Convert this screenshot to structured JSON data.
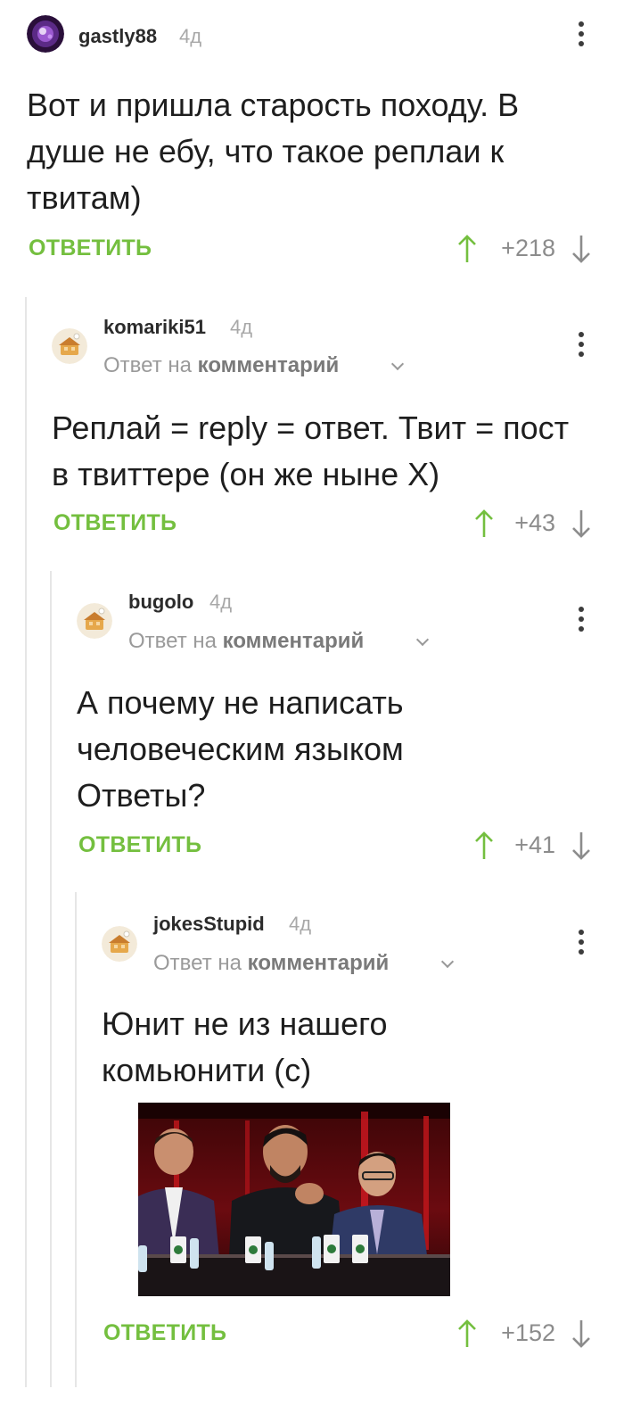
{
  "comments": [
    {
      "username": "gastly88",
      "age": "4д",
      "text": "Вот и пришла старость походу. В душе не ебу, что такое реплаи к твитам)",
      "reply_label": "ОТВЕТИТЬ",
      "score": "+218"
    },
    {
      "username": "komariki51",
      "age": "4д",
      "reply_to_prefix": "Ответ на",
      "reply_to_link": "комментарий",
      "text": "Реплай = reply = ответ. Твит = пост в твиттере (он же ныне Х)",
      "reply_label": "ОТВЕТИТЬ",
      "score": "+43"
    },
    {
      "username": "bugolo",
      "age": "4д",
      "reply_to_prefix": "Ответ на",
      "reply_to_link": "комментарий",
      "text": "А почему не написать человеческим языком Ответы?",
      "reply_label": "ОТВЕТИТЬ",
      "score": "+41"
    },
    {
      "username": "jokesStupid",
      "age": "4д",
      "reply_to_prefix": "Ответ на",
      "reply_to_link": "комментарий",
      "text": "Юнит не из нашего комьюнити (с)",
      "reply_label": "ОТВЕТИТЬ",
      "score": "+152"
    }
  ],
  "colors": {
    "accent_green": "#74bf3f",
    "score_gray": "#8c8c8c",
    "thread_line": "#e6e6e6"
  },
  "icons": [
    "more-vertical-icon",
    "arrow-up-icon",
    "arrow-down-icon",
    "chevron-down-icon"
  ]
}
